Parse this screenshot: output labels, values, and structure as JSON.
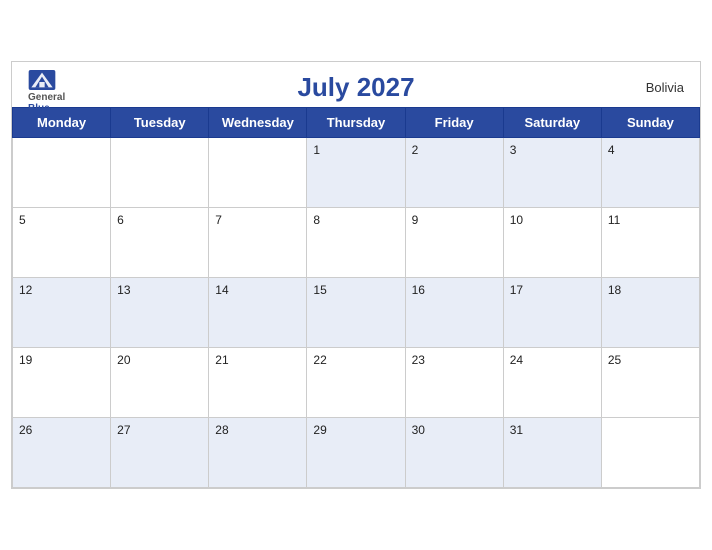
{
  "calendar": {
    "title": "July 2027",
    "country": "Bolivia",
    "days_of_week": [
      "Monday",
      "Tuesday",
      "Wednesday",
      "Thursday",
      "Friday",
      "Saturday",
      "Sunday"
    ],
    "weeks": [
      [
        "",
        "",
        "",
        "1",
        "2",
        "3",
        "4"
      ],
      [
        "5",
        "6",
        "7",
        "8",
        "9",
        "10",
        "11"
      ],
      [
        "12",
        "13",
        "14",
        "15",
        "16",
        "17",
        "18"
      ],
      [
        "19",
        "20",
        "21",
        "22",
        "23",
        "24",
        "25"
      ],
      [
        "26",
        "27",
        "28",
        "29",
        "30",
        "31",
        ""
      ]
    ]
  },
  "logo": {
    "general": "General",
    "blue": "Blue"
  }
}
